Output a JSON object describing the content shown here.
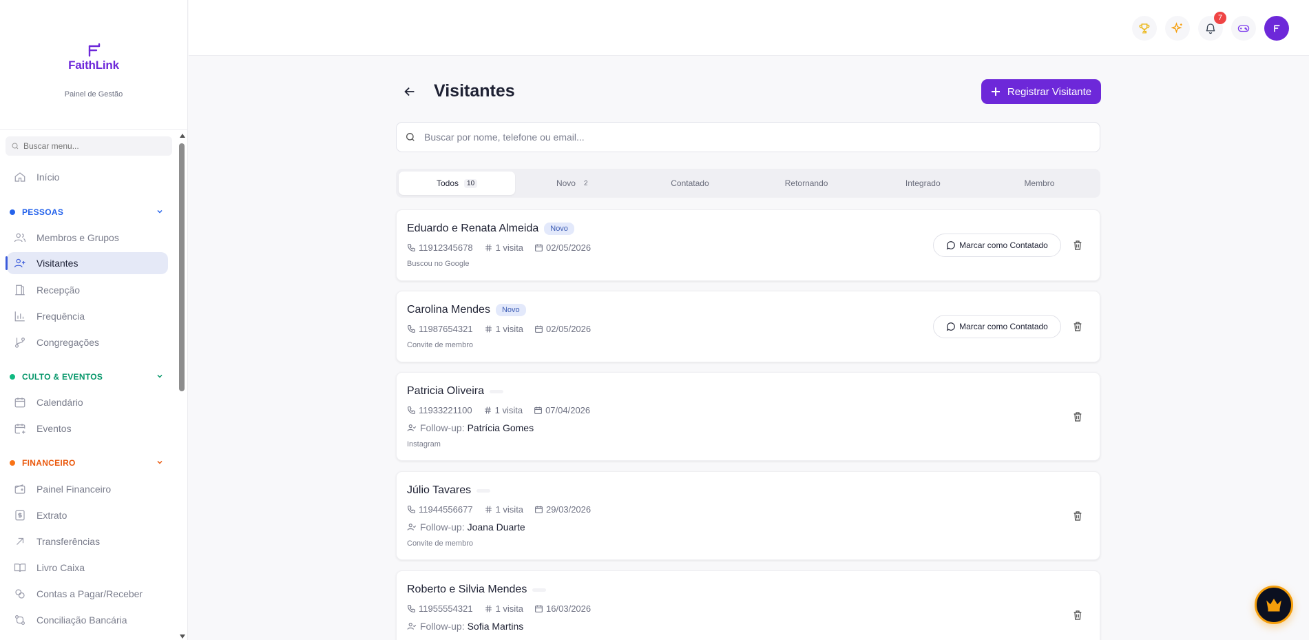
{
  "brand": {
    "name": "FaithLink",
    "subtitle": "Painel de Gestão"
  },
  "sidebar": {
    "search_placeholder": "Buscar menu...",
    "home": "Início",
    "sections": [
      {
        "title": "PESSOAS",
        "color": "#2563eb",
        "items": [
          "Membros e Grupos",
          "Visitantes",
          "Recepção",
          "Frequência",
          "Congregações"
        ]
      },
      {
        "title": "CULTO & EVENTOS",
        "color": "#059669",
        "items": [
          "Calendário",
          "Eventos"
        ]
      },
      {
        "title": "FINANCEIRO",
        "color": "#ea580c",
        "items": [
          "Painel Financeiro",
          "Extrato",
          "Transferências",
          "Livro Caixa",
          "Contas a Pagar/Receber",
          "Conciliação Bancária"
        ]
      }
    ],
    "active_item": "Visitantes"
  },
  "topbar": {
    "notifications_count": "7",
    "icons": [
      "trophy-icon",
      "sparkles-icon",
      "bell-icon",
      "gamepad-icon",
      "avatar"
    ]
  },
  "page": {
    "title": "Visitantes",
    "primary_action": "Registrar Visitante",
    "search_placeholder": "Buscar por nome, telefone ou email..."
  },
  "tabs": [
    {
      "label": "Todos",
      "count": "10"
    },
    {
      "label": "Novo",
      "count": "2"
    },
    {
      "label": "Contatado",
      "count": ""
    },
    {
      "label": "Retornando",
      "count": ""
    },
    {
      "label": "Integrado",
      "count": ""
    },
    {
      "label": "Membro",
      "count": ""
    }
  ],
  "visitors": [
    {
      "name": "Eduardo e Renata Almeida",
      "status": "Novo",
      "phone": "11912345678",
      "visits": "1 visita",
      "date": "02/05/2026",
      "followup_label": "",
      "followup": "",
      "source": "Buscou no Google",
      "action": "Marcar como Contatado"
    },
    {
      "name": "Carolina Mendes",
      "status": "Novo",
      "phone": "11987654321",
      "visits": "1 visita",
      "date": "02/05/2026",
      "followup_label": "",
      "followup": "",
      "source": "Convite de membro",
      "action": "Marcar como Contatado"
    },
    {
      "name": "Patricia Oliveira",
      "status": "",
      "phone": "11933221100",
      "visits": "1 visita",
      "date": "07/04/2026",
      "followup_label": "Follow-up:",
      "followup": "Patrícia Gomes",
      "source": "Instagram",
      "action": ""
    },
    {
      "name": "Júlio Tavares",
      "status": "",
      "phone": "11944556677",
      "visits": "1 visita",
      "date": "29/03/2026",
      "followup_label": "Follow-up:",
      "followup": "Joana Duarte",
      "source": "Convite de membro",
      "action": ""
    },
    {
      "name": "Roberto e Silvia Mendes",
      "status": "",
      "phone": "11955554321",
      "visits": "1 visita",
      "date": "16/03/2026",
      "followup_label": "Follow-up:",
      "followup": "Sofia Martins",
      "source": "",
      "action": ""
    }
  ]
}
